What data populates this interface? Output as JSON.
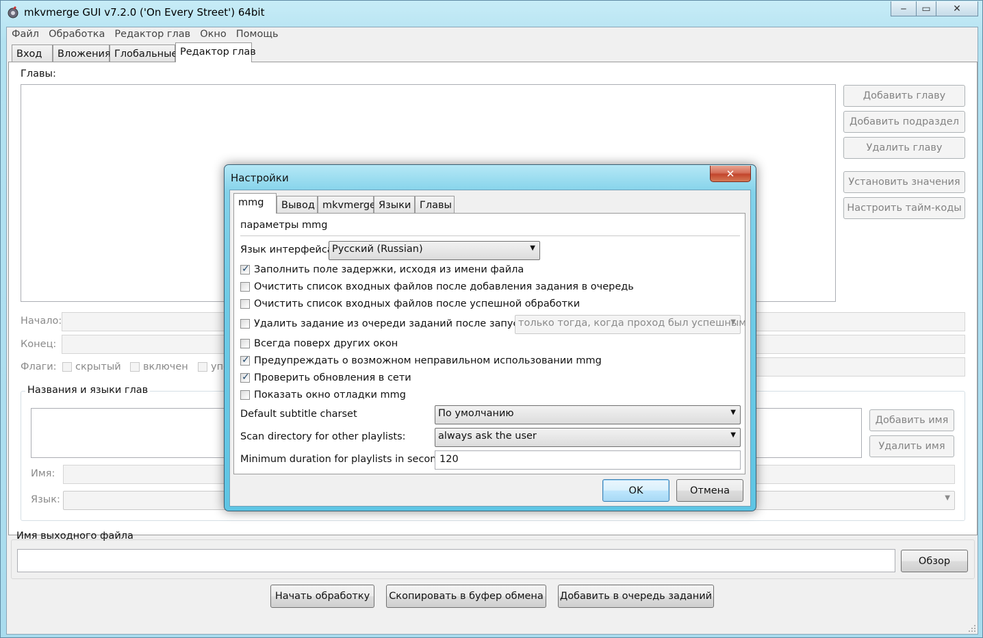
{
  "window": {
    "title": "mkvmerge GUI v7.2.0 ('On Every Street') 64bit",
    "minimize": "‒",
    "maximize": "▭",
    "close": "✕"
  },
  "menu": [
    "Файл",
    "Обработка",
    "Редактор глав",
    "Окно",
    "Помощь"
  ],
  "tabs": [
    "Вход",
    "Вложения",
    "Глобальные",
    "Редактор глав"
  ],
  "chapters": {
    "label": "Главы:",
    "buttons": {
      "add_chapter": "Добавить главу",
      "add_subchapter": "Добавить подраздел",
      "remove_chapter": "Удалить главу",
      "set_values": "Установить значения",
      "adjust_timecodes": "Настроить тайм-коды"
    },
    "start_label": "Начало:",
    "end_label": "Конец:",
    "flags_label": "Флаги:",
    "flag_hidden": "скрытый",
    "flag_enabled": "включен",
    "flag_partial": "упо"
  },
  "names": {
    "group_label": "Названия и языки глав",
    "name_label": "Имя:",
    "language_label": "Язык:",
    "add_name": "Добавить имя",
    "remove_name": "Удалить имя"
  },
  "output": {
    "label": "Имя выходного файла",
    "browse": "Обзор"
  },
  "actions": {
    "start": "Начать обработку",
    "copy": "Скопировать в буфер обмена",
    "queue": "Добавить в очередь заданий"
  },
  "dialog": {
    "title": "Настройки",
    "close": "✕",
    "tabs": [
      "mmg",
      "Вывод",
      "mkvmerge",
      "Языки",
      "Главы"
    ],
    "heading": "параметры mmg",
    "ui_language_label": "Язык интерфейса:",
    "ui_language_value": "Русский (Russian)",
    "checks": [
      {
        "label": "Заполнить поле задержки, исходя из имени файла",
        "checked": true
      },
      {
        "label": "Очистить список входных файлов после добавления задания в очередь",
        "checked": false
      },
      {
        "label": "Очистить список входных файлов после успешной обработки",
        "checked": false
      },
      {
        "label": "Удалить задание из очереди заданий после запуска:",
        "checked": false
      },
      {
        "label": "Всегда поверх других окон",
        "checked": false
      },
      {
        "label": "Предупреждать о возможном неправильном использовании mmg",
        "checked": true
      },
      {
        "label": "Проверить обновления в сети",
        "checked": true
      },
      {
        "label": "Показать окно отладки mmg",
        "checked": false
      }
    ],
    "remove_job_option": "только тогда, когда проход был успешным",
    "subtitle_charset_label": "Default subtitle charset",
    "subtitle_charset_value": "По умолчанию",
    "scan_dir_label": "Scan directory for other playlists:",
    "scan_dir_value": "always ask the user",
    "min_duration_label": "Minimum duration for playlists in seconds:",
    "min_duration_value": "120",
    "ok": "OK",
    "cancel": "Отмена"
  }
}
